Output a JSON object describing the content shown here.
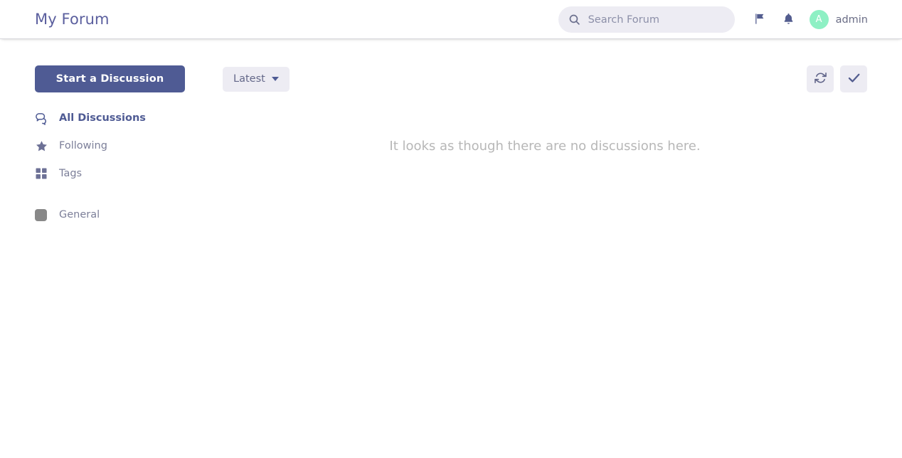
{
  "header": {
    "title": "My Forum",
    "search": {
      "placeholder": "Search Forum",
      "value": "",
      "icon": "search-icon"
    },
    "flag_icon": "flag-icon",
    "notifications_icon": "bell-icon",
    "user": {
      "name": "admin",
      "avatar_initial": "A",
      "avatar_color": "#8ef0c4"
    }
  },
  "sidebar": {
    "start_discussion_label": "Start a Discussion",
    "nav_items": [
      {
        "label": "All Discussions",
        "icon": "comments-icon",
        "active": true
      },
      {
        "label": "Following",
        "icon": "star-icon",
        "active": false
      },
      {
        "label": "Tags",
        "icon": "grid-icon",
        "active": false
      }
    ],
    "tags": [
      {
        "label": "General",
        "color": "#888888",
        "icon": "tag-swatch-icon"
      }
    ]
  },
  "toolbar": {
    "sort_label": "Latest",
    "sort_caret_icon": "chevron-down-icon",
    "refresh_label": "Refresh",
    "refresh_icon": "refresh-icon",
    "mark_all_read_label": "Mark all as read",
    "mark_all_read_icon": "check-icon"
  },
  "main": {
    "empty_state_text": "It looks as though there are no discussions here."
  },
  "colors": {
    "primary": "#4f5b94",
    "muted": "#7c7f99",
    "control_bg": "#edecf3",
    "empty_text": "#b7b7b7"
  }
}
